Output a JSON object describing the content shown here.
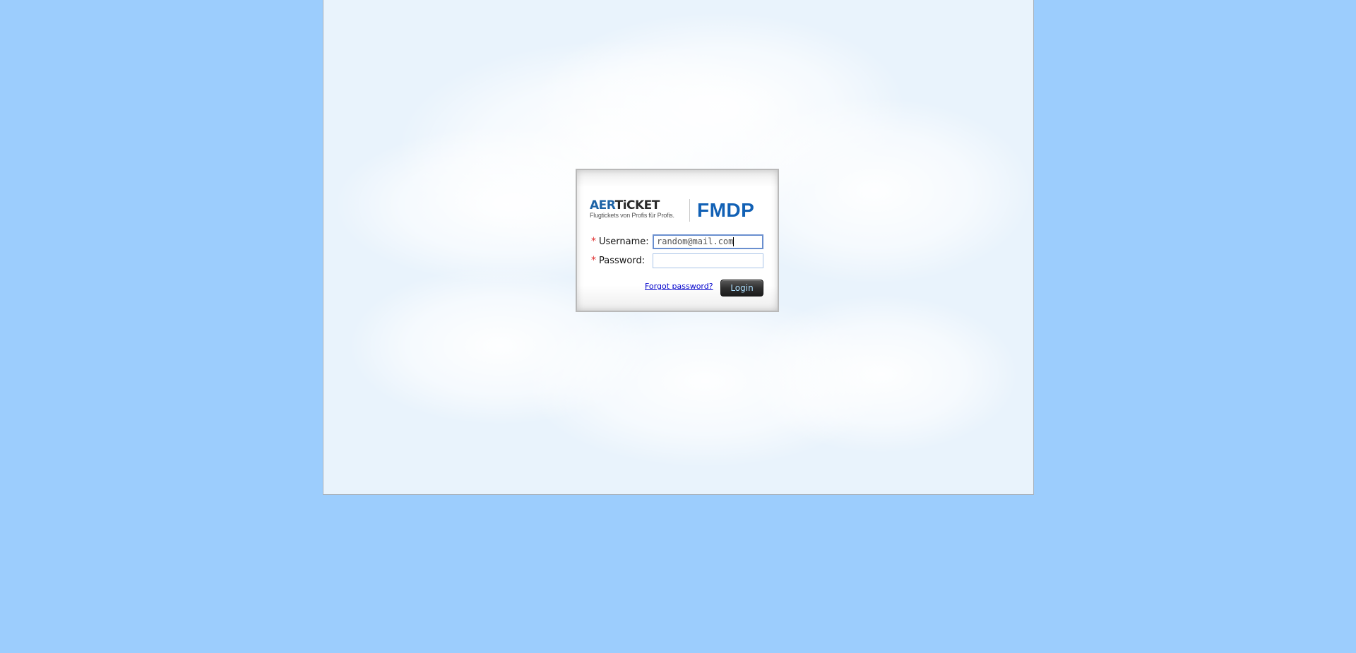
{
  "branding": {
    "aer_logo_prefix": "AER",
    "aer_logo_suffix": "TiCKET",
    "aer_tagline": "Flugtickets von Profis für Profis.",
    "product_name": "FMDP"
  },
  "login_form": {
    "required_marker": "*",
    "username_label": "Username:",
    "username_value": "random@mail.com",
    "password_label": "Password:",
    "password_value": "",
    "forgot_password_link": "Forgot password?",
    "login_button": "Login"
  },
  "colors": {
    "page_background": "#9ccdfd",
    "brand_blue": "#1261b5",
    "required_red": "#e03232",
    "link_blue": "#0000cc"
  }
}
